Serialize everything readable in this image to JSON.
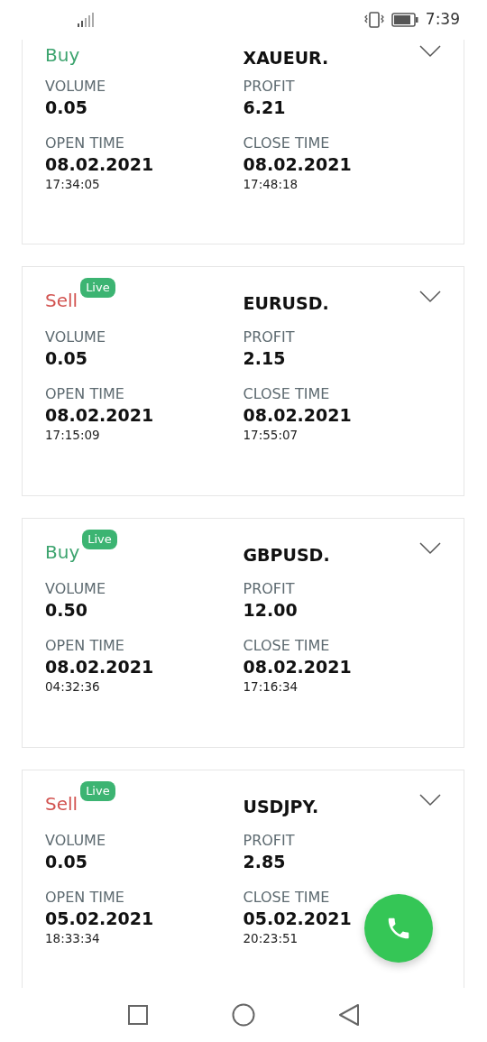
{
  "status_bar": {
    "time": "7:39"
  },
  "trades": [
    {
      "side": "Buy",
      "kind": "buy",
      "symbol": "XAUEUR.",
      "expanded": false,
      "volume_label": "VOLUME",
      "volume": "0.05",
      "profit_label": "PROFIT",
      "profit": "6.21",
      "open_label": "OPEN TIME",
      "open_date": "08.02.2021",
      "open_time": "17:34:05",
      "close_label": "CLOSE TIME",
      "close_date": "08.02.2021",
      "close_time": "17:48:18"
    },
    {
      "side": "Sell",
      "kind": "sell",
      "badge": "Live",
      "symbol": "EURUSD.",
      "expanded": false,
      "volume_label": "VOLUME",
      "volume": "0.05",
      "profit_label": "PROFIT",
      "profit": "2.15",
      "open_label": "OPEN TIME",
      "open_date": "08.02.2021",
      "open_time": "17:15:09",
      "close_label": "CLOSE TIME",
      "close_date": "08.02.2021",
      "close_time": "17:55:07"
    },
    {
      "side": "Buy",
      "kind": "buy",
      "badge": "Live",
      "symbol": "GBPUSD.",
      "expanded": false,
      "volume_label": "VOLUME",
      "volume": "0.50",
      "profit_label": "PROFIT",
      "profit": "12.00",
      "open_label": "OPEN TIME",
      "open_date": "08.02.2021",
      "open_time": "04:32:36",
      "close_label": "CLOSE TIME",
      "close_date": "08.02.2021",
      "close_time": "17:16:34"
    },
    {
      "side": "Sell",
      "kind": "sell",
      "badge": "Live",
      "symbol": "USDJPY.",
      "expanded": false,
      "volume_label": "VOLUME",
      "volume": "0.05",
      "profit_label": "PROFIT",
      "profit": "2.85",
      "open_label": "OPEN TIME",
      "open_date": "05.02.2021",
      "open_time": "18:33:34",
      "close_label": "CLOSE TIME",
      "close_date": "05.02.2021",
      "close_time": "20:23:51"
    }
  ]
}
